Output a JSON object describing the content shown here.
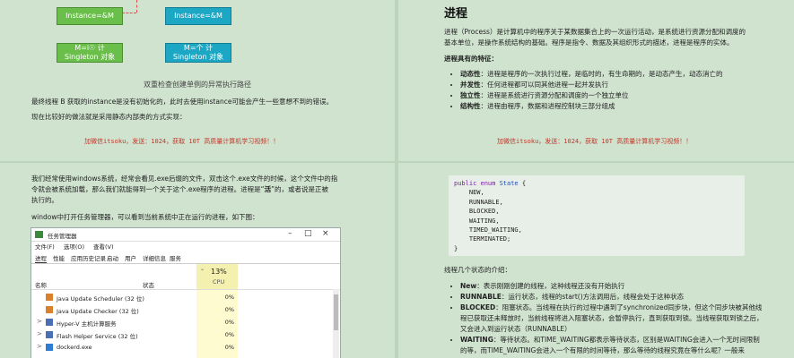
{
  "top_left": {
    "boxes": {
      "instance_green": "Instance=&M",
      "instance_cyan": "Instance=&M",
      "singleton_green": "M=i☉ 计\nSingleton 对象",
      "singleton_cyan": "M=个 计\nSingleton 对象"
    },
    "caption": "双重检查创建单例的异常执行路径",
    "para1": "最终线程 B 获取的instance是没有初始化的，此时去使用instance可能会产生一些意想不到的错误。",
    "para2": "现在比较好的做法就是采用静态内部类的方式实现：",
    "promo": "加微信itsoku，发送：1024，获取 10T 高质量计算机学习视频！！"
  },
  "top_right": {
    "title": "进程",
    "intro_line1": "进程（Process）是计算机中的程序关于某数据集合上的一次运行活动，是系统进行资源分配和调度的",
    "intro_line2": "基本单位，是操作系统结构的基础。程序是指令、数据及其组织形式的描述，进程是程序的实体。",
    "features_heading": "进程具有的特征：",
    "features": [
      {
        "term": "动态性",
        "desc": "：进程是程序的一次执行过程，是临时的，有生命期的，是动态产生，动态消亡的"
      },
      {
        "term": "并发性",
        "desc": "：任何进程都可以同其他进程一起并发执行"
      },
      {
        "term": "独立性",
        "desc": "：进程是系统进行资源分配和调度的一个独立单位"
      },
      {
        "term": "结构性",
        "desc": "：进程由程序，数据和进程控制块三部分组成"
      }
    ],
    "promo": "加微信itsoku，发送：1024，获取 10T 高质量计算机学习视频！！"
  },
  "bottom_left": {
    "para1_line1": "我们经常使用windows系统，经常会看见.exe后缀的文件，双击这个.exe文件的时候，这个文件中的指",
    "para1_line2": "令就会被系统加载，那么我们就能得到一个关于这个.exe程序的进程。进程是“",
    "para1_bold": "活",
    "para1_line2_end": "”的，或者说是正被",
    "para1_line3": "执行的。",
    "para2": "window中打开任务管理器，可以看到当前系统中正在运行的进程，如下图：",
    "task_manager": {
      "title": "任务管理器",
      "menu": [
        "文件(F)",
        "选项(O)",
        "查看(V)"
      ],
      "tabs": [
        "进程",
        "性能",
        "应用历史记录",
        "启动",
        "用户",
        "详细信息",
        "服务"
      ],
      "col_name": "名称",
      "col_status": "状态",
      "cpu_percent": "13%",
      "cpu_label": "CPU",
      "rows": [
        {
          "name": "Java Update Scheduler (32 位)",
          "cpu": "0%",
          "expand": ""
        },
        {
          "name": "Java Update Checker (32 位)",
          "cpu": "0%",
          "expand": ""
        },
        {
          "name": "Hyper-V 主机计算服务",
          "cpu": "0%",
          "expand": ">"
        },
        {
          "name": "Flash Helper Service (32 位)",
          "cpu": "0%",
          "expand": ">"
        },
        {
          "name": "dockerd.exe",
          "cpu": "0%",
          "expand": ">"
        }
      ]
    }
  },
  "bottom_right": {
    "code_lines": [
      "public enum State {",
      "    NEW,",
      "    RUNNABLE,",
      "    BLOCKED,",
      "    WAITING,",
      "    TIMED_WAITING,",
      "    TERMINATED;",
      "}"
    ],
    "states_heading": "线程几个状态的介绍：",
    "states": [
      {
        "term": "New",
        "desc": "：表示刚刚创建的线程，这种线程还没有开始执行"
      },
      {
        "term": "RUNNABLE",
        "desc": "：运行状态，线程的start()方法调用后，线程会处于这种状态"
      },
      {
        "term": "BLOCKED",
        "desc": "：阻塞状态。当线程在执行的过程中遇到了synchronized同步块，但这个同步块被其他线程已获取还未释放时，当前线程将进入阻塞状态，会暂停执行，直到获取到锁。当线程获取到锁之后，又会进入到运行状态（RUNNABLE）"
      },
      {
        "term": "WAITING",
        "desc": "：等待状态。和TIME_WAITING都表示等待状态，区别是WAITING会进入一个无时间限制的等，而TIME_WAITING会进入一个有限的时间等待，那么等待的线程究竟在等什么呢？一般来"
      }
    ]
  }
}
